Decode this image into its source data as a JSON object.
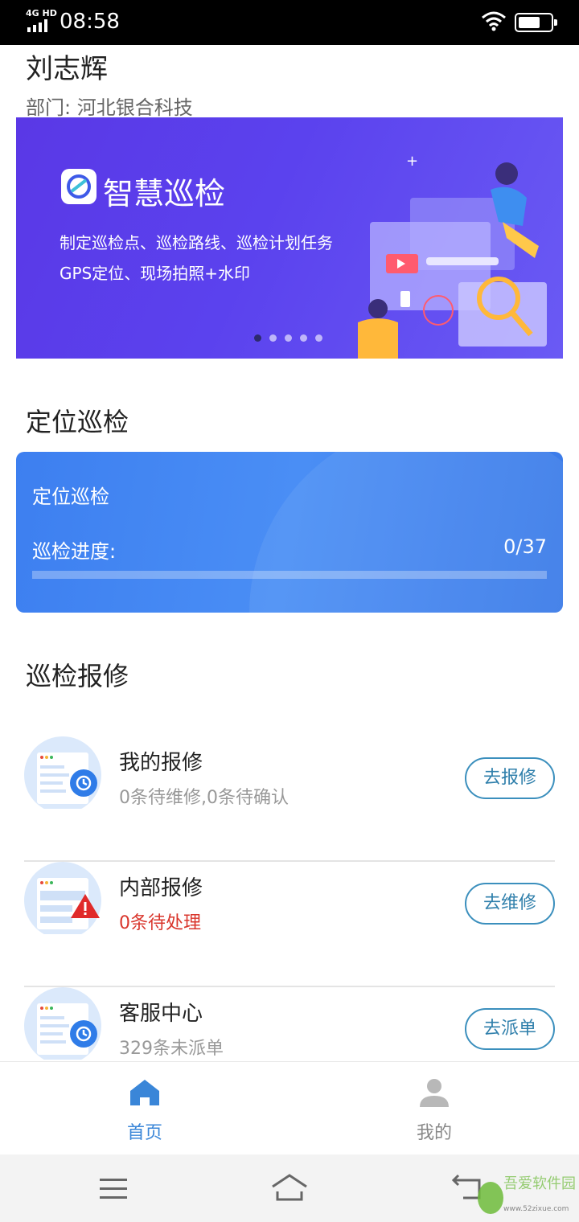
{
  "status_bar": {
    "network": "4G HD",
    "time": "08:58"
  },
  "user": {
    "name": "刘志辉",
    "department": "部门:  河北银合科技"
  },
  "banner": {
    "title": "智慧巡检",
    "line1": "制定巡检点、巡检路线、巡检计划任务",
    "line2": "GPS定位、现场拍照+水印",
    "slide_count": 5,
    "active_slide": 0
  },
  "section_locate": {
    "title": "定位巡检"
  },
  "inspect_card": {
    "title": "定位巡检",
    "progress_label": "巡检进度:",
    "progress_value": "0/37",
    "progress_fraction": 0
  },
  "section_repair": {
    "title": "巡检报修"
  },
  "repair_items": [
    {
      "title": "我的报修",
      "subtitle": "0条待维修,0条待确认",
      "button": "去报修",
      "icon": "history-icon"
    },
    {
      "title": "内部报修",
      "subtitle": "0条待处理",
      "button": "去维修",
      "icon": "warning-icon"
    },
    {
      "title": "客服中心",
      "subtitle": "329条未派单",
      "button": "去派单",
      "icon": "history-icon"
    }
  ],
  "tabs": [
    {
      "label": "首页",
      "icon": "home-icon",
      "active": true
    },
    {
      "label": "我的",
      "icon": "person-icon",
      "active": false
    }
  ],
  "watermark": {
    "text": "吾爱软件园",
    "url": "www.52zixue.com"
  },
  "colors": {
    "accent": "#3d7ff0",
    "banner": "#5a38e6",
    "alert": "#d9362c",
    "button_border": "#3b8fbd",
    "tab_active": "#3a86d8",
    "tab_inactive": "#999999"
  }
}
